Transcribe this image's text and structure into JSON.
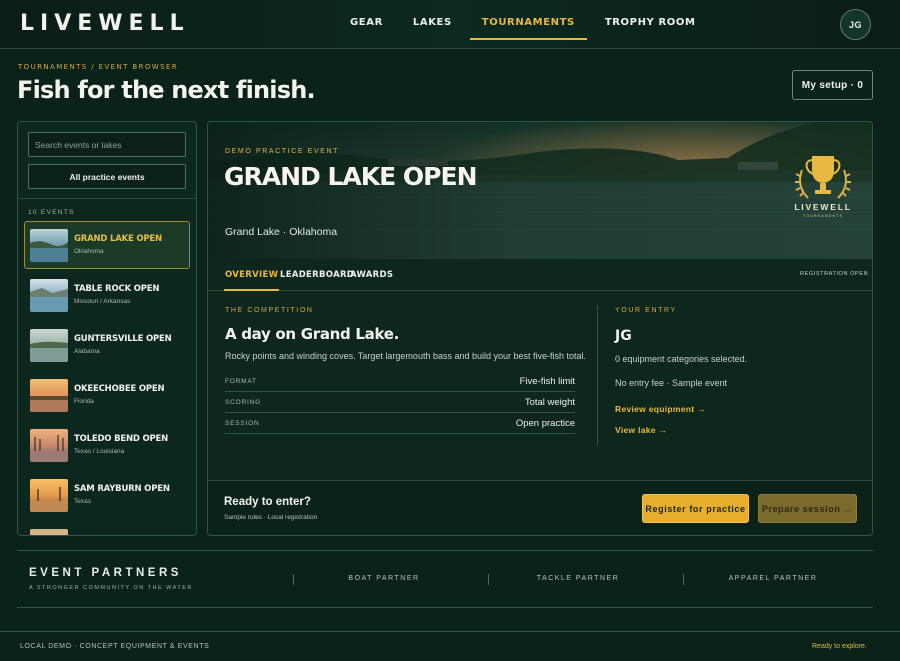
{
  "brand": {
    "logo": "LIVEWELL"
  },
  "nav": {
    "items": [
      {
        "label": "GEAR"
      },
      {
        "label": "LAKES"
      },
      {
        "label": "TOURNAMENTS"
      },
      {
        "label": "TROPHY ROOM"
      }
    ],
    "active": "TOURNAMENTS",
    "avatar": "JG"
  },
  "header": {
    "breadcrumb": "TOURNAMENTS / EVENT BROWSER",
    "title": "Fish for the next finish.",
    "setup_button": "My setup · 0"
  },
  "sidebar": {
    "search_placeholder": "Search events or lakes",
    "filter_button": "All practice events",
    "count_label": "10 EVENTS",
    "events": [
      {
        "name": "GRAND LAKE OPEN",
        "location": "Oklahoma",
        "selected": true
      },
      {
        "name": "TABLE ROCK OPEN",
        "location": "Missouri / Arkansas"
      },
      {
        "name": "GUNTERSVILLE OPEN",
        "location": "Alabama"
      },
      {
        "name": "OKEECHOBEE OPEN",
        "location": "Florida"
      },
      {
        "name": "TOLEDO BEND OPEN",
        "location": "Texas / Louisiana"
      },
      {
        "name": "SAM RAYBURN OPEN",
        "location": "Texas"
      }
    ]
  },
  "event": {
    "kicker": "DEMO PRACTICE EVENT",
    "title": "GRAND LAKE OPEN",
    "location": "Grand Lake · Oklahoma",
    "badge": {
      "name": "LIVEWELL",
      "sub": "TOURNAMENTS",
      "icon": "trophy-icon"
    },
    "tabs": [
      {
        "label": "OVERVIEW"
      },
      {
        "label": "LEADERBOARD"
      },
      {
        "label": "AWARDS"
      }
    ],
    "status": "REGISTRATION OPEN",
    "competition": {
      "label": "THE COMPETITION",
      "title": "A day on Grand Lake.",
      "description": "Rocky points and winding coves. Target largemouth bass and build your best five-fish total.",
      "specs": [
        {
          "key": "FORMAT",
          "value": "Five-fish limit"
        },
        {
          "key": "SCORING",
          "value": "Total weight"
        },
        {
          "key": "SESSION",
          "value": "Open practice"
        }
      ]
    },
    "entry": {
      "label": "YOUR ENTRY",
      "name": "JG",
      "equipment": "0 equipment categories selected.",
      "fee": "No entry fee · Sample event",
      "review_link": "Review equipment →",
      "lake_link": "View lake →"
    },
    "cta": {
      "title": "Ready to enter?",
      "subtitle": "Sample rules · Local registration",
      "register": "Register for practice",
      "prepare": "Prepare session →"
    }
  },
  "partners": {
    "title": "EVENT PARTNERS",
    "subtitle": "A STRONGER COMMUNITY ON THE WATER",
    "items": [
      "BOAT PARTNER",
      "TACKLE PARTNER",
      "APPAREL PARTNER"
    ]
  },
  "footer": {
    "legal": "LOCAL DEMO · CONCEPT EQUIPMENT & EVENTS",
    "status": "Ready to explore."
  },
  "colors": {
    "accent": "#e7b940",
    "background": "#0b2219",
    "panel": "#0c271d"
  }
}
